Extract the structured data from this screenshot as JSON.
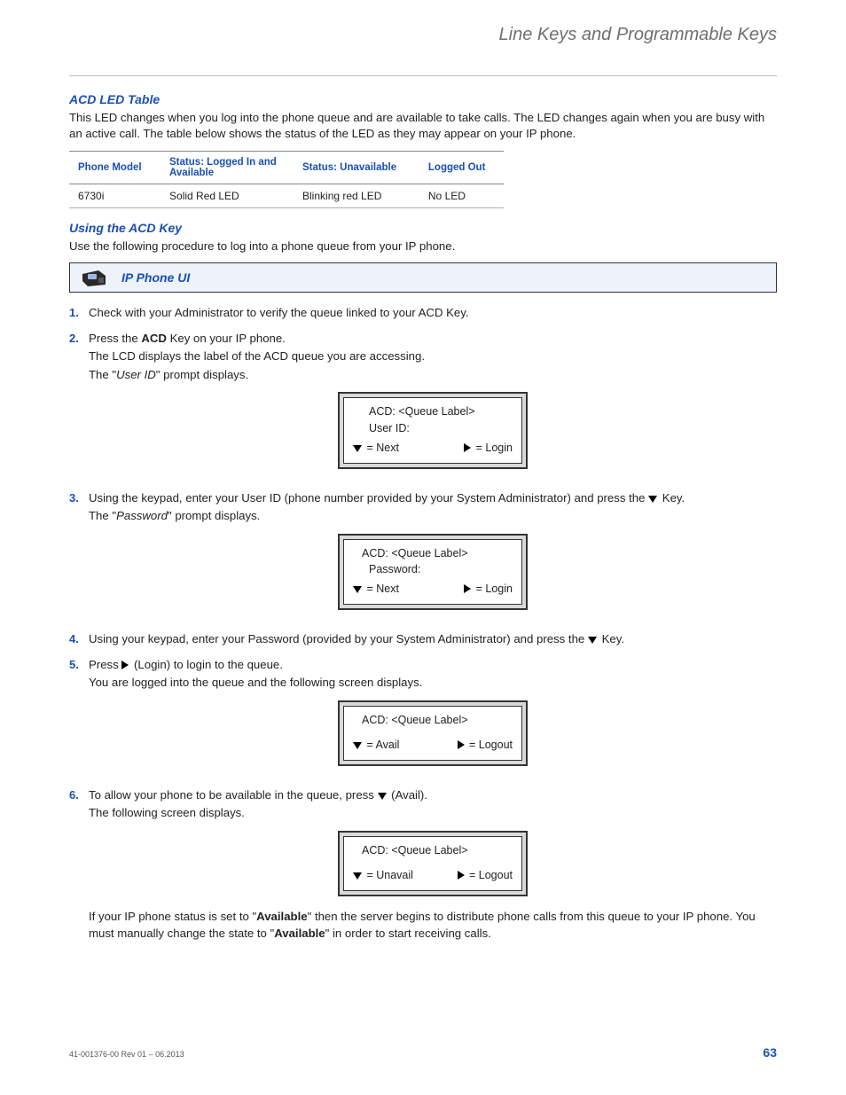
{
  "header": {
    "running_title": "Line Keys and Programmable Keys"
  },
  "section1": {
    "title": "ACD LED Table",
    "intro": "This LED changes when you log into the phone queue and are available to take calls. The LED changes again when you are busy with an active call. The table below shows the status of the LED as they may appear on your IP phone."
  },
  "table": {
    "headers": [
      "Phone Model",
      "Status: Logged In and Available",
      "Status: Unavailable",
      "Logged Out"
    ],
    "rows": [
      [
        "6730i",
        "Solid Red LED",
        "Blinking red LED",
        "No LED"
      ]
    ]
  },
  "section2": {
    "title": "Using the ACD Key",
    "intro": "Use the following procedure to log into a phone queue from your IP phone."
  },
  "callout": {
    "title": "IP Phone UI"
  },
  "steps": {
    "s1": "Check with your Administrator to verify the queue linked to your ACD Key.",
    "s2_a": "Press the ",
    "s2_bold": "ACD",
    "s2_b": " Key on your IP phone.",
    "s2_sub1": "The LCD displays the label of the ACD queue you are accessing.",
    "s2_sub2_a": "The \"",
    "s2_sub2_i": "User ID",
    "s2_sub2_b": "\" prompt displays.",
    "s3_a": "Using the keypad, enter your User ID (phone number provided by your System Administrator) and press the ",
    "s3_b": " Key.",
    "s3_sub_a": "The \"",
    "s3_sub_i": "Password",
    "s3_sub_b": "\" prompt displays.",
    "s4_a": "Using your keypad, enter your Password (provided by your System Administrator) and press the ",
    "s4_b": " Key.",
    "s5_a": "Press ",
    "s5_b": " (Login) to login to the queue.",
    "s5_sub": "You are logged into the queue and the following screen displays.",
    "s6_a": "To allow your phone to be available in the queue, press ",
    "s6_b": " (Avail).",
    "s6_sub": "The following screen displays.",
    "tail_a": "If your IP phone status is set to \"",
    "tail_bold1": "Available",
    "tail_b": "\" then the server begins to distribute phone calls from this queue to your IP phone. You must manually change the state to \"",
    "tail_bold2": "Available",
    "tail_c": "\" in order to start receiving calls."
  },
  "lcd1": {
    "l1": "ACD: <Queue Label>",
    "l2": "User ID:",
    "left": " = Next",
    "right": " = Login"
  },
  "lcd2": {
    "l1": "ACD: <Queue Label>",
    "l2": "Password:",
    "left": " = Next",
    "right": " = Login"
  },
  "lcd3": {
    "l1": "ACD: <Queue Label>",
    "left": " = Avail",
    "right": " = Logout"
  },
  "lcd4": {
    "l1": "ACD: <Queue Label>",
    "left": " = Unavail",
    "right": " = Logout"
  },
  "footer": {
    "doc_rev": "41-001376-00 Rev 01 – 06.2013",
    "page_num": "63"
  }
}
